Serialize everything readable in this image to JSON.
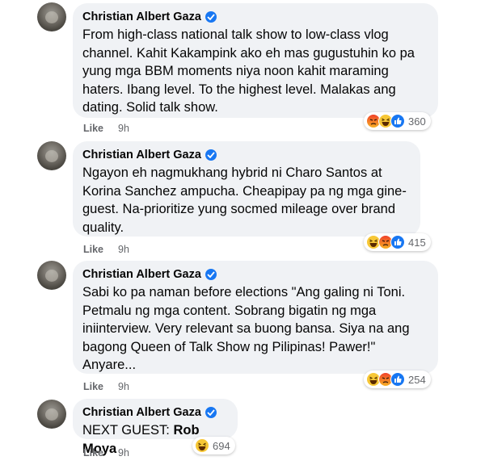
{
  "comments": [
    {
      "author": "Christian Albert Gaza",
      "text": "From high-class national talk show to low-class vlog channel. Kahit Kakampink ako eh mas gugustuhin ko pa yung mga BBM moments niya noon kahit maraming haters. Ibang level. To the highest level. Malakas ang dating. Solid talk show.",
      "like_label": "Like",
      "time": "9h",
      "reactions": [
        "angry",
        "haha",
        "like"
      ],
      "reaction_count": "360"
    },
    {
      "author": "Christian Albert Gaza",
      "text": "Ngayon eh nagmukhang hybrid ni Charo Santos at Korina Sanchez ampucha. Cheapipay pa ng mga gine-guest. Na-prioritize yung socmed mileage over brand quality.",
      "like_label": "Like",
      "time": "9h",
      "reactions": [
        "haha",
        "angry",
        "like"
      ],
      "reaction_count": "415"
    },
    {
      "author": "Christian Albert Gaza",
      "text": "Sabi ko pa naman before elections \"Ang galing ni Toni. Petmalu ng mga content. Sobrang bigatin ng mga iniinterview. Very relevant sa buong bansa. Siya na ang bagong Queen of Talk Show ng Pilipinas! Pawer!\" Anyare...",
      "like_label": "Like",
      "time": "9h",
      "reactions": [
        "haha",
        "angry",
        "like"
      ],
      "reaction_count": "254"
    },
    {
      "author": "Christian Albert Gaza",
      "text_prefix": "NEXT GUEST: ",
      "mention": "Rob Moya",
      "like_label": "Like",
      "time": "9h",
      "reactions": [
        "haha"
      ],
      "reaction_count": "694"
    }
  ],
  "icons": {
    "verified": "verified-badge-icon",
    "reaction_angry": "angry-reaction-icon",
    "reaction_haha": "haha-reaction-icon",
    "reaction_like": "like-reaction-icon"
  },
  "colors": {
    "bubble": "#f0f2f5",
    "verified": "#1877f2",
    "meta_text": "#65676b"
  }
}
